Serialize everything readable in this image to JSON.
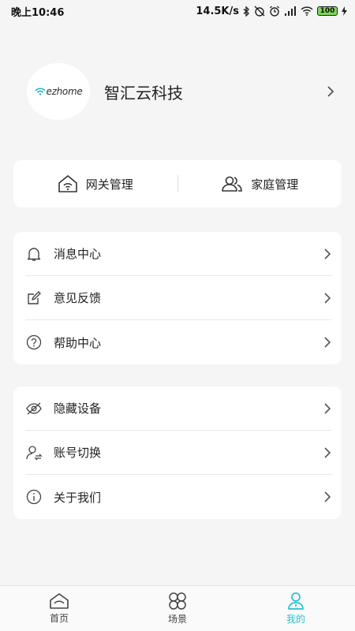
{
  "status_bar": {
    "time": "晚上10:46",
    "speed": "14.5K/s",
    "battery": "100"
  },
  "profile": {
    "logo_text": "ezhome",
    "name": "智汇云科技"
  },
  "quick": {
    "gateway": "网关管理",
    "family": "家庭管理"
  },
  "menu_group1": [
    {
      "label": "消息中心",
      "icon": "bell-icon"
    },
    {
      "label": "意见反馈",
      "icon": "edit-icon"
    },
    {
      "label": "帮助中心",
      "icon": "help-icon"
    }
  ],
  "menu_group2": [
    {
      "label": "隐藏设备",
      "icon": "eye-off-icon"
    },
    {
      "label": "账号切换",
      "icon": "switch-account-icon"
    },
    {
      "label": "关于我们",
      "icon": "info-icon"
    }
  ],
  "nav": {
    "home": "首页",
    "scene": "场景",
    "mine": "我的"
  },
  "colors": {
    "accent": "#29bfd2",
    "background": "#f5f5f5",
    "card": "#ffffff"
  }
}
